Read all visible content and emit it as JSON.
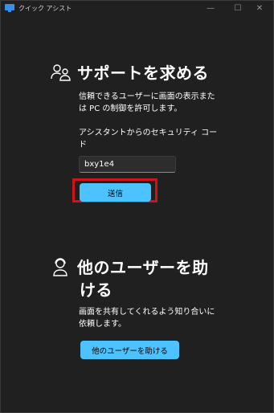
{
  "window": {
    "title": "クイック アシスト",
    "controls": {
      "minimize": "—",
      "maximize": "☐",
      "close": "✕"
    }
  },
  "get_help": {
    "icon": "people-icon",
    "title": "サポートを求める",
    "description_line1": "信頼できるユーザーに画面の表示また",
    "description_line2": "は PC の制御を許可します。",
    "code_label_line1": "アシスタントからのセキュリティ コー",
    "code_label_line2": "ド",
    "code_value": "bxy1e4",
    "submit_label": "送信"
  },
  "help_someone": {
    "icon": "person-headset-icon",
    "title_line1": "他のユーザーを助",
    "title_line2": "ける",
    "description_line1": "画面を共有してくれるよう知り合いに",
    "description_line2": "依頼します。",
    "button_label": "他のユーザーを助ける"
  },
  "colors": {
    "background": "#202020",
    "accent": "#4cc2ff",
    "highlight": "#d0121b"
  }
}
